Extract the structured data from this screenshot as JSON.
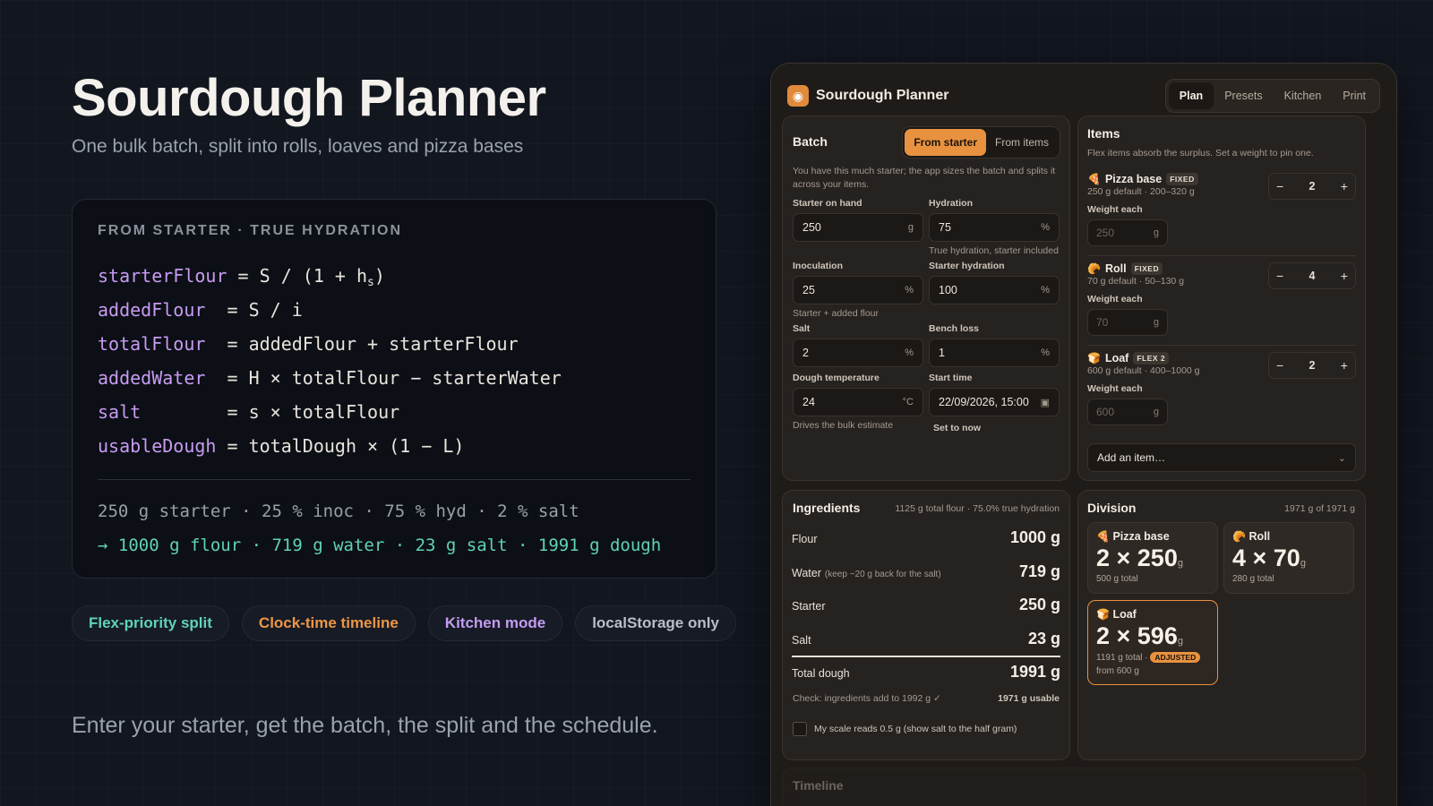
{
  "hero": {
    "title": "Sourdough Planner",
    "subtitle": "One bulk batch, split into rolls, loaves and pizza bases",
    "tagline": "Enter your starter, get the batch, the split and the schedule."
  },
  "formula": {
    "label": "FROM STARTER · TRUE HYDRATION",
    "lines": [
      {
        "var": "starterFlour",
        "pad": " ",
        "expr_pre": "= S / (1 + h",
        "sub": "s",
        "expr_post": ")"
      },
      {
        "var": "addedFlour",
        "pad": "  ",
        "expr_pre": "= S / i",
        "sub": "",
        "expr_post": ""
      },
      {
        "var": "totalFlour",
        "pad": "  ",
        "expr_pre": "= addedFlour + starterFlour",
        "sub": "",
        "expr_post": ""
      },
      {
        "var": "addedWater",
        "pad": "  ",
        "expr_pre": "= H × totalFlour − starterWater",
        "sub": "",
        "expr_post": ""
      },
      {
        "var": "salt",
        "pad": "        ",
        "expr_pre": "= s × totalFlour",
        "sub": "",
        "expr_post": ""
      },
      {
        "var": "usableDough",
        "pad": " ",
        "expr_pre": "= totalDough × (1 − L)",
        "sub": "",
        "expr_post": ""
      }
    ],
    "example_in": "250 g starter · 25 % inoc · 75 % hyd · 2 % salt",
    "example_out": "→ 1000 g flour · 719 g water · 23 g salt · 1991 g dough"
  },
  "pills": [
    {
      "label": "Flex-priority split",
      "color": "#5fd3b8"
    },
    {
      "label": "Clock-time timeline",
      "color": "#ee9645"
    },
    {
      "label": "Kitchen mode",
      "color": "#c49bf2"
    },
    {
      "label": "localStorage only",
      "color": "#b9bfc8"
    }
  ],
  "app": {
    "title": "Sourdough Planner",
    "tabs": [
      "Plan",
      "Presets",
      "Kitchen",
      "Print"
    ],
    "batch": {
      "title": "Batch",
      "mode_a": "From starter",
      "mode_b": "From items",
      "hint": "You have this much starter; the app sizes the batch and splits it across your items.",
      "starter_label": "Starter on hand",
      "starter_value": "250",
      "starter_unit": "g",
      "hydration_label": "Hydration",
      "hydration_value": "75",
      "hydration_unit": "%",
      "hydration_hint": "True hydration, starter included",
      "inoc_label": "Inoculation",
      "inoc_value": "25",
      "inoc_unit": "%",
      "inoc_hint": "Starter + added flour",
      "starterhyd_label": "Starter hydration",
      "starterhyd_value": "100",
      "starterhyd_unit": "%",
      "salt_label": "Salt",
      "salt_value": "2",
      "salt_unit": "%",
      "bench_label": "Bench loss",
      "bench_value": "1",
      "bench_unit": "%",
      "temp_label": "Dough temperature",
      "temp_value": "24",
      "temp_unit": "°C",
      "temp_hint": "Drives the bulk estimate",
      "start_label": "Start time",
      "start_value": "22/09/2026, 15:00",
      "set_now": "Set to now"
    },
    "items": {
      "title": "Items",
      "hint": "Flex items absorb the surplus. Set a weight to pin one.",
      "list": [
        {
          "name": "Pizza base",
          "badge": "FIXED",
          "desc": "250 g default · 200–320 g",
          "count": "2",
          "weight_label": "Weight each",
          "weight_placeholder": "250",
          "unit": "g",
          "icon": "🍕"
        },
        {
          "name": "Roll",
          "badge": "FIXED",
          "desc": "70 g default · 50–130 g",
          "count": "4",
          "weight_label": "Weight each",
          "weight_placeholder": "70",
          "unit": "g",
          "icon": "🥐"
        },
        {
          "name": "Loaf",
          "badge": "FLEX 2",
          "desc": "600 g default · 400–1000 g",
          "count": "2",
          "weight_label": "Weight each",
          "weight_placeholder": "600",
          "unit": "g",
          "icon": "🍞"
        }
      ],
      "add_item": "Add an item…"
    },
    "ingredients": {
      "title": "Ingredients",
      "summary": "1125 g total flour · 75.0% true hydration",
      "rows": [
        {
          "name": "Flour",
          "note": "",
          "value": "1000 g"
        },
        {
          "name": "Water",
          "note": "(keep ~20 g back for the salt)",
          "value": "719 g"
        },
        {
          "name": "Starter",
          "note": "",
          "value": "250 g"
        },
        {
          "name": "Salt",
          "note": "",
          "value": "23 g"
        }
      ],
      "total_label": "Total dough",
      "total_value": "1991 g",
      "check": "Check: ingredients add to 1992 g ✓",
      "usable": "1971 g usable",
      "scale_label": "My scale reads 0.5 g (show salt to the half gram)"
    },
    "division": {
      "title": "Division",
      "summary": "1971 g of 1971 g",
      "boxes": [
        {
          "name": "Pizza base",
          "big": "2 × 250",
          "unit": "g",
          "total": "500 g total",
          "icon": "🍕"
        },
        {
          "name": "Roll",
          "big": "4 × 70",
          "unit": "g",
          "total": "280 g total",
          "icon": "🥐"
        },
        {
          "name": "Loaf",
          "big": "2 × 596",
          "unit": "g",
          "total": "1191 g total ·",
          "adjusted": "ADJUSTED",
          "from": "from 600 g",
          "icon": "🍞"
        }
      ]
    },
    "timeline": {
      "title": "Timeline"
    }
  }
}
